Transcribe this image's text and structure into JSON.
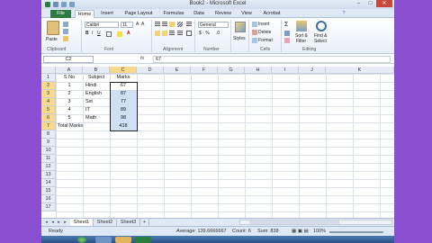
{
  "window": {
    "title": "Book2 - Microsoft Excel",
    "controls": {
      "minimize": "–",
      "maximize": "□",
      "close": "✕"
    }
  },
  "ribbon_tabs": {
    "file": "File",
    "home": "Home",
    "insert": "Insert",
    "page_layout": "Page Layout",
    "formulas": "Formulas",
    "data": "Data",
    "review": "Review",
    "view": "View",
    "acrobat": "Acrobat"
  },
  "ribbon": {
    "paste": "Paste",
    "font_name": "Calibri",
    "font_size": "11",
    "number_format": "General",
    "styles": "Styles",
    "insert": "Insert",
    "delete": "Delete",
    "format": "Format",
    "sort_filter": "Sort &",
    "sort_filter2": "Filter",
    "find_select": "Find &",
    "find_select2": "Select",
    "groups": {
      "clipboard": "Clipboard",
      "font": "Font",
      "alignment": "Alignment",
      "number": "Number",
      "cells": "Cells",
      "editing": "Editing"
    }
  },
  "formula_bar": {
    "name_box": "C2",
    "fx": "fx",
    "value": "67"
  },
  "columns": [
    "A",
    "B",
    "C",
    "D",
    "E",
    "F",
    "G",
    "H",
    "I",
    "J",
    "K"
  ],
  "rows": [
    "1",
    "2",
    "3",
    "4",
    "5",
    "6",
    "7",
    "8",
    "9",
    "10",
    "11",
    "12",
    "13",
    "14",
    "15",
    "16",
    "17"
  ],
  "table": {
    "headers": {
      "sno": "S No",
      "subject": "Subject",
      "marks": "Marks"
    },
    "rows": [
      {
        "sno": "1",
        "subject": "Hindi",
        "marks": "67"
      },
      {
        "sno": "2",
        "subject": "English",
        "marks": "87"
      },
      {
        "sno": "3",
        "subject": "Sst",
        "marks": "77"
      },
      {
        "sno": "4",
        "subject": "IT",
        "marks": "89"
      },
      {
        "sno": "5",
        "subject": "Math",
        "marks": "98"
      }
    ],
    "total_label": "Total Marks",
    "total_value": "418"
  },
  "sheets": [
    "Sheet1",
    "Sheet2",
    "Sheet3"
  ],
  "status": {
    "mode": "Ready",
    "average": "Average: 139.6666667",
    "count": "Count: 6",
    "sum": "Sum: 838",
    "zoom": "100%"
  },
  "colors": {
    "file_tab": "#2d7c3f",
    "selection": "#cfe0f4",
    "header_selected": "#f9d98b",
    "background": "#8a4fd0"
  }
}
